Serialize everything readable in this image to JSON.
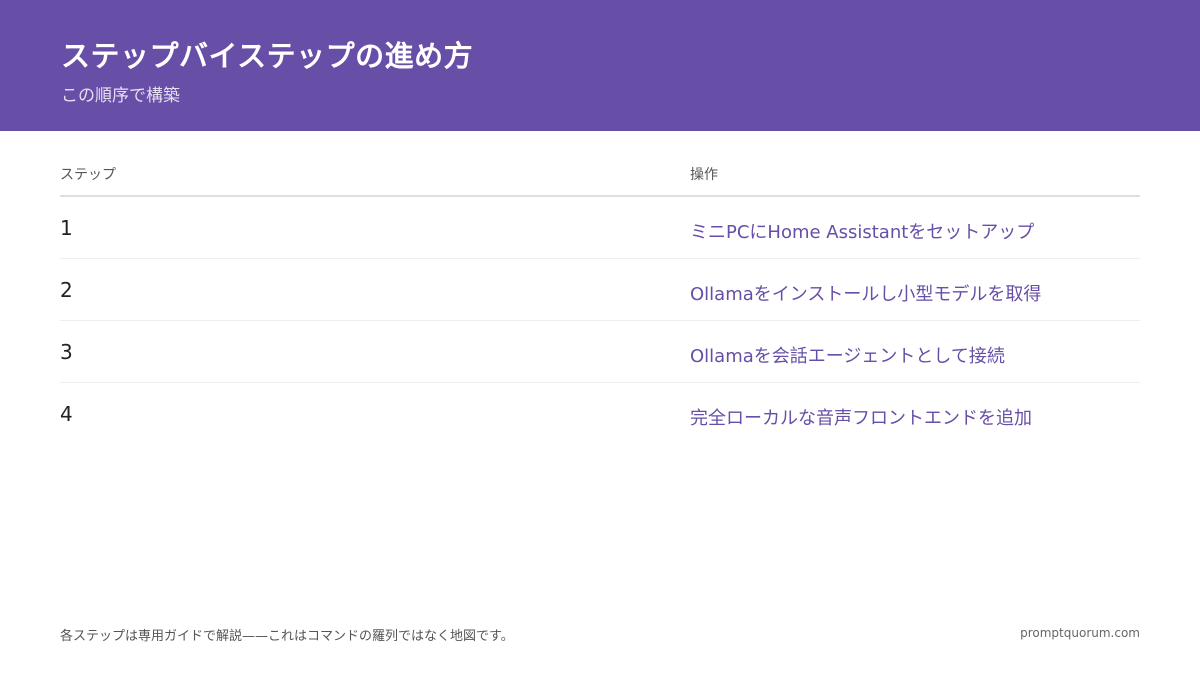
{
  "header": {
    "title": "ステップバイステップの進め方",
    "subtitle": "この順序で構築"
  },
  "table": {
    "columns": [
      "ステップ",
      "操作"
    ],
    "rows": [
      {
        "step": "1",
        "action": "ミニPCにHome Assistantをセットアップ"
      },
      {
        "step": "2",
        "action": "Ollamaをインストールし小型モデルを取得"
      },
      {
        "step": "3",
        "action": "Ollamaを会話エージェントとして接続"
      },
      {
        "step": "4",
        "action": "完全ローカルな音声フロントエンドを追加"
      }
    ]
  },
  "footer": {
    "note": "各ステップは専用ガイドで解説——これはコマンドの羅列ではなく地図です。",
    "domain": "promptquorum.com"
  },
  "colors": {
    "header_bg": "#674ea7",
    "accent": "#674ea7"
  }
}
